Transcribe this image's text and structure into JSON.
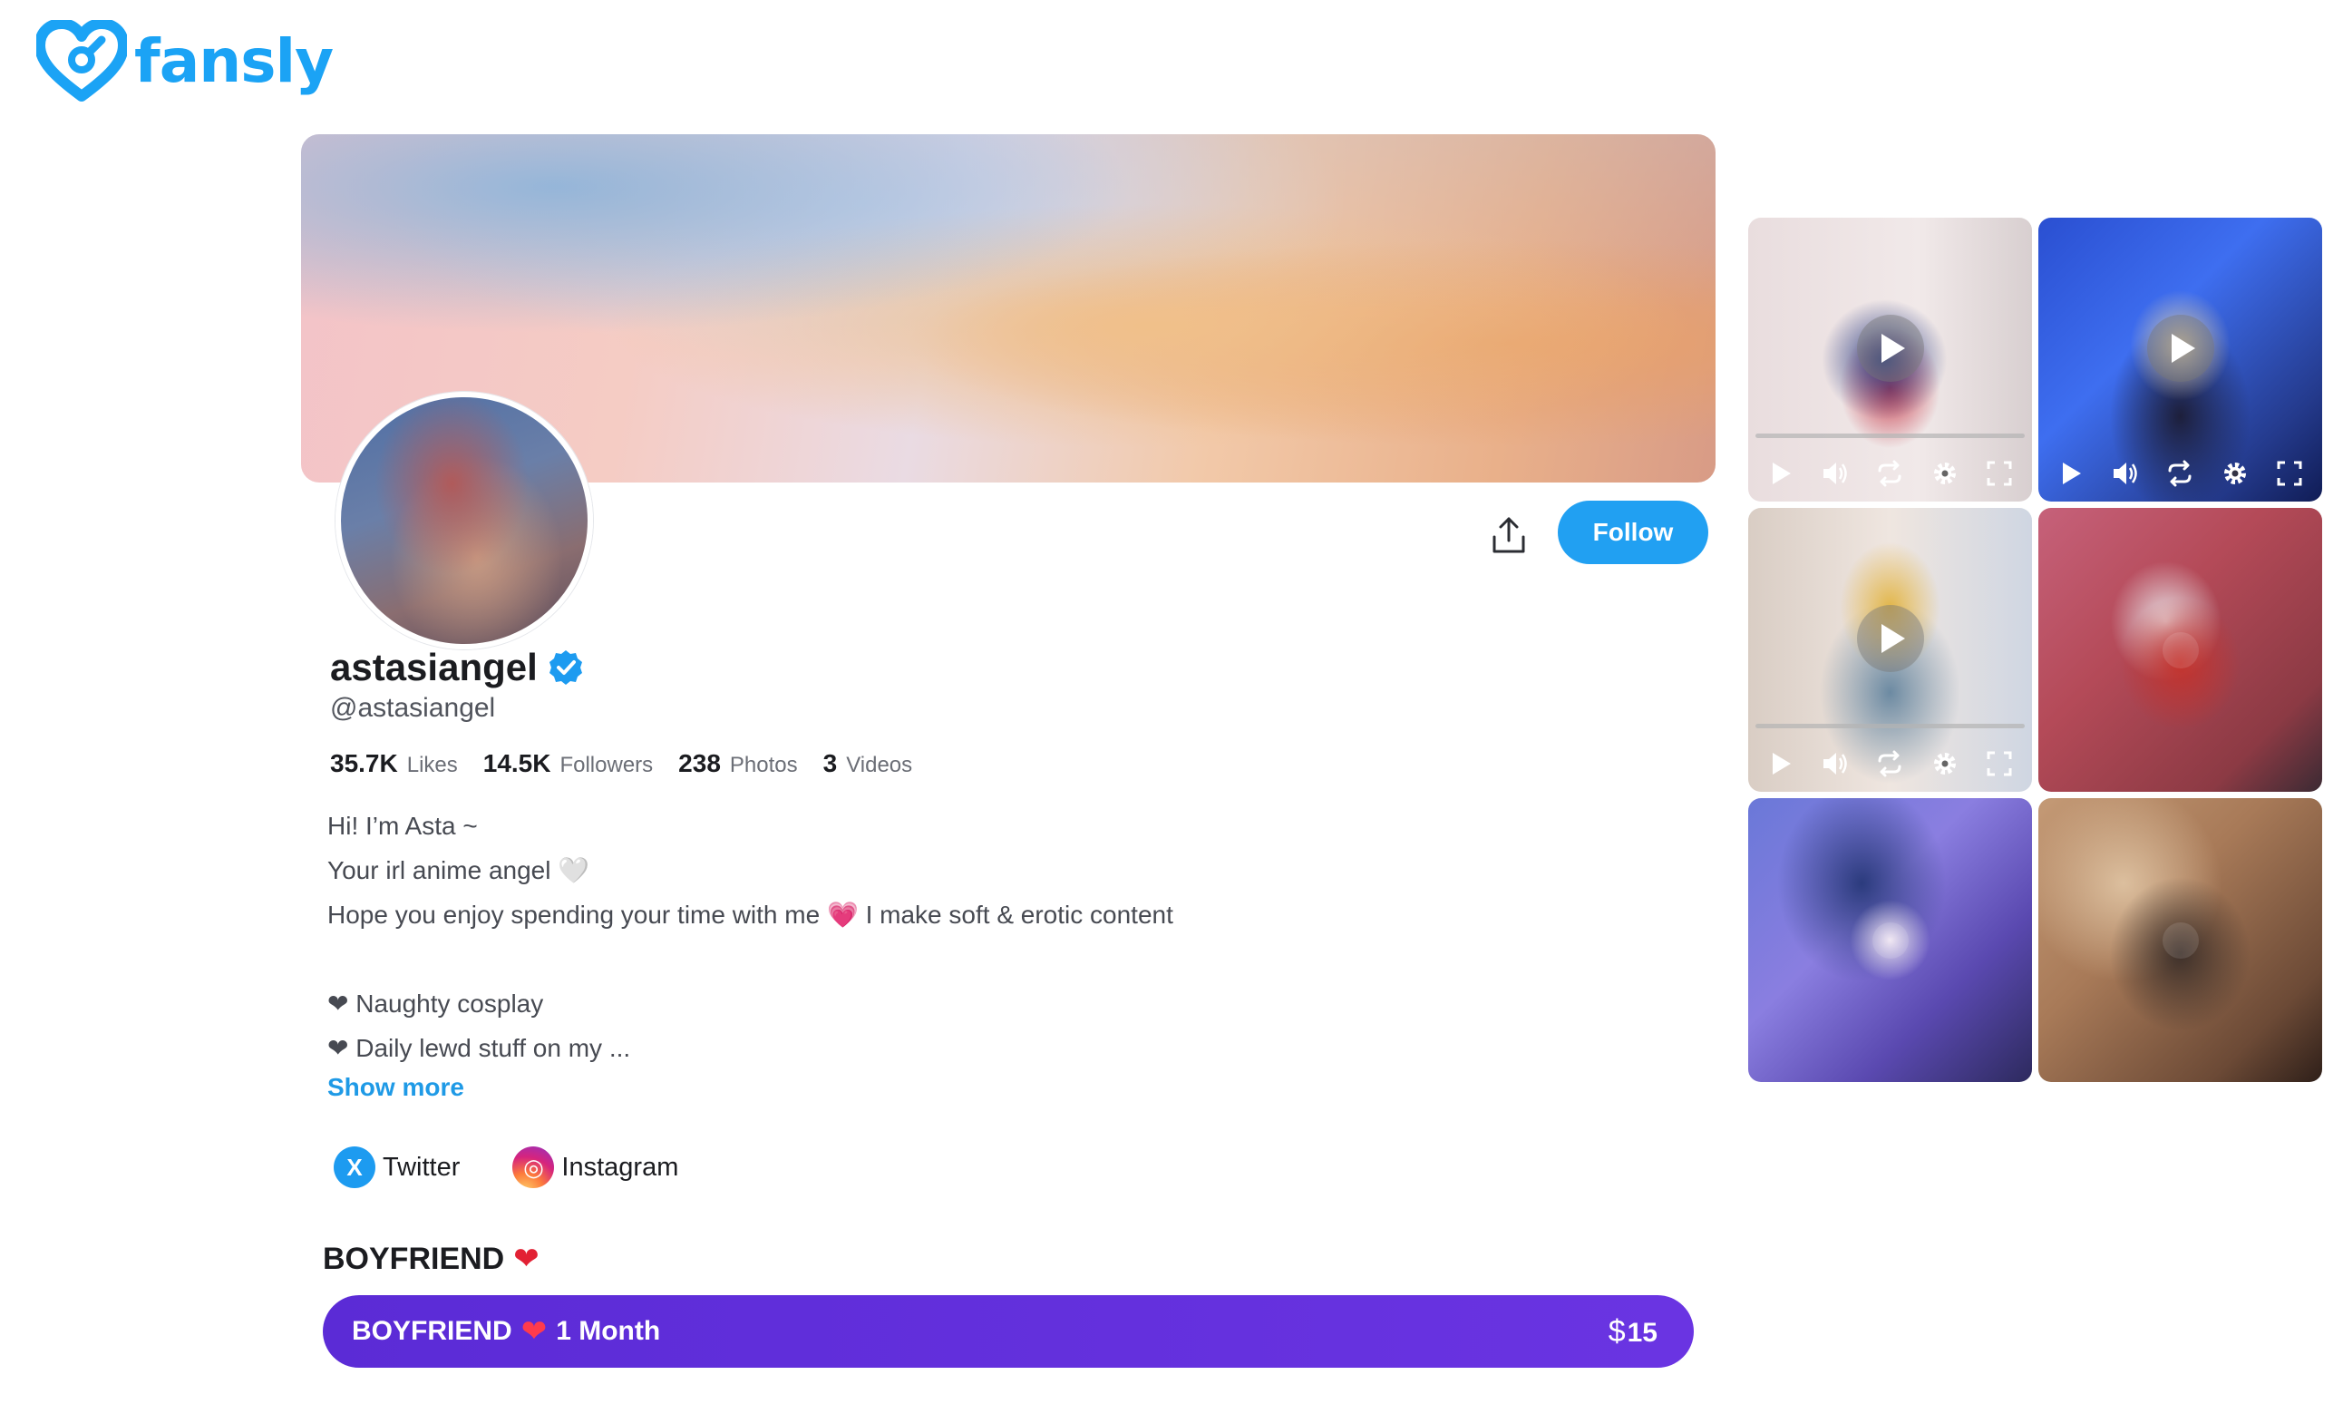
{
  "brand": {
    "name": "fansly",
    "color": "#1ba3f5"
  },
  "profile": {
    "display_name": "astasiangel",
    "handle": "@astasiangel",
    "verified": true,
    "stats": [
      {
        "value": "35.7K",
        "label": "Likes"
      },
      {
        "value": "14.5K",
        "label": "Followers"
      },
      {
        "value": "238",
        "label": "Photos"
      },
      {
        "value": "3",
        "label": "Videos"
      }
    ],
    "bio": [
      "Hi! I’m Asta ~",
      "Your irl anime angel  🤍",
      "Hope you enjoy spending your time with me 💗 I make soft & erotic content",
      "",
      "❤ Naughty cosplay",
      "❤ Daily lewd stuff on my ..."
    ],
    "show_more_label": "Show more"
  },
  "actions": {
    "share_icon": "share-icon",
    "follow_label": "Follow"
  },
  "socials": [
    {
      "name": "Twitter",
      "icon": "x-icon",
      "glyph": "X"
    },
    {
      "name": "Instagram",
      "icon": "instagram-icon",
      "glyph": "◎"
    }
  ],
  "tier": {
    "heading": "BOYFRIEND",
    "heading_emoji": "❤",
    "button_name": "BOYFRIEND",
    "button_emoji": "❤",
    "duration": "1 Month",
    "currency": "$",
    "price": "15",
    "color": "#5b2bd6"
  },
  "media": {
    "tiles": [
      {
        "kind": "video",
        "player": true
      },
      {
        "kind": "video",
        "player": true
      },
      {
        "kind": "video",
        "player": true
      },
      {
        "kind": "image",
        "player": false
      },
      {
        "kind": "image",
        "player": false
      },
      {
        "kind": "image",
        "player": false
      }
    ]
  }
}
